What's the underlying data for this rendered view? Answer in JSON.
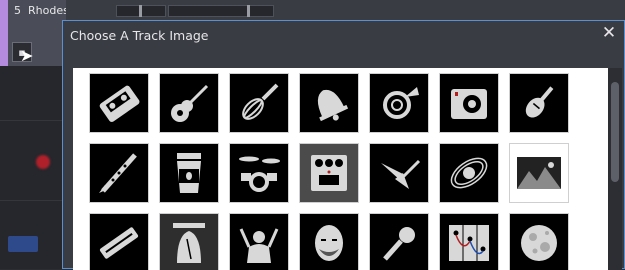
{
  "track": {
    "number": "5",
    "name": "Rhodes"
  },
  "dialog": {
    "title": "Choose A Track Image",
    "close_glyph": "✕"
  },
  "images": [
    {
      "icon": "cassette-icon"
    },
    {
      "icon": "acoustic-guitar-icon"
    },
    {
      "icon": "whisk-icon"
    },
    {
      "icon": "bell-icon"
    },
    {
      "icon": "french-horn-icon"
    },
    {
      "icon": "speaker-cabinet-icon"
    },
    {
      "icon": "violin-icon"
    },
    {
      "icon": "clarinet-icon"
    },
    {
      "icon": "coffee-cup-icon"
    },
    {
      "icon": "drum-kit-icon"
    },
    {
      "icon": "effects-pedal-icon"
    },
    {
      "icon": "electric-guitar-icon"
    },
    {
      "icon": "planet-orbit-icon"
    },
    {
      "icon": "landscape-photo-icon"
    },
    {
      "icon": "harmonica-icon"
    },
    {
      "icon": "liberty-bell-icon"
    },
    {
      "icon": "conductor-icon"
    },
    {
      "icon": "bearded-face-icon"
    },
    {
      "icon": "microphone-icon"
    },
    {
      "icon": "modular-synth-icon"
    },
    {
      "icon": "moon-icon"
    }
  ]
}
